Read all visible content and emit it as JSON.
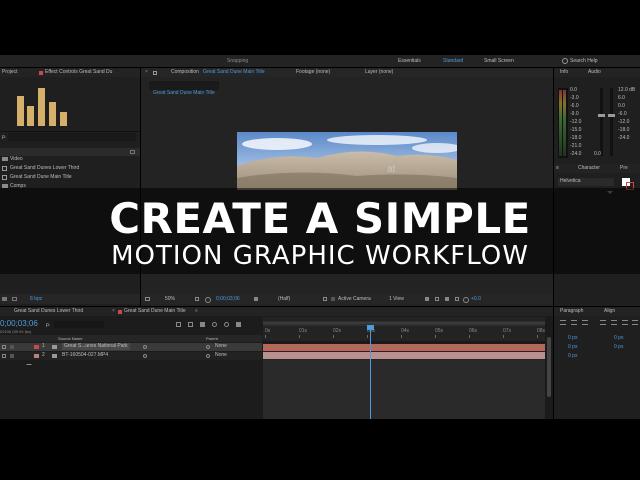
{
  "top_bar": {
    "workspace_label": "Snapping",
    "essentials": "Essentials",
    "standard": "Standard",
    "small_screen": "Small Screen",
    "search": "Search Help"
  },
  "project_panel": {
    "tab_project": "Project",
    "tab_effect_controls": "Effect Controls Great Sand Du",
    "search_icon_glyph": "ρ.",
    "items": [
      {
        "name": "Video",
        "icon": "folder-icon"
      },
      {
        "name": "Great Sand Dunes Lower Third",
        "icon": "composition-icon"
      },
      {
        "name": "Great Sand Dune Main Title",
        "icon": "composition-icon"
      },
      {
        "name": "Comps",
        "icon": "folder-icon"
      }
    ],
    "bpc": "8 bpc"
  },
  "composition_panel": {
    "tab_prefix": "Composition",
    "tab_name": "Great Sand Dune Main Title",
    "footage_tab": "Footage (none)",
    "layer_tab": "Layer (none)",
    "active_chip": "Great Sand Dune Main Title",
    "watermark": "at",
    "zoom": "50%",
    "timecode": "0;00;03;06",
    "resolution": "(Half)",
    "camera": "Active Camera",
    "views": "1 View",
    "exposure": "+0.0"
  },
  "right_panel": {
    "tab_info": "Info",
    "tab_audio": "Audio",
    "meter_left": [
      "0.0",
      "-3.0",
      "-6.0",
      "-9.0",
      "-12.0",
      "-15.0",
      "-18.0",
      "-21.0",
      "-24.0"
    ],
    "meter_right": [
      "12.0 dB",
      "6.0",
      "0.0",
      "-6.0",
      "-12.0",
      "-18.0",
      "-24.0"
    ],
    "meter_right_unit": "dB",
    "meter_mid_zero": "0.0",
    "tab_character": "Character",
    "tab_pre": "Pre",
    "font": "Helvetica",
    "tab_paragraph": "Paragraph",
    "tab_align": "Align",
    "para_values": [
      "0 px",
      "0 px",
      "0 px",
      "0 px",
      "0 px"
    ]
  },
  "title_overlay": {
    "line1": "CREATE A SIMPLE",
    "line2": "MOTION GRAPHIC WORKFLOW"
  },
  "timeline": {
    "tab_lower_third": "Great Sand Dunes Lower Third",
    "tab_main_title": "Great Sand Dune Main Title",
    "timecode": "0;00;03;06",
    "fps": "00106 (59.94 fps)",
    "search_glyph": "ρ.",
    "col_source": "Source Name",
    "col_parent": "Parent",
    "ruler": [
      "0s",
      "01s",
      "02s",
      "03s",
      "04s",
      "05s",
      "06s",
      "07s",
      "08s"
    ],
    "playhead_seconds": 3.1,
    "layers": [
      {
        "num": "1",
        "name": "Great S...unes National Park",
        "parent": "None",
        "selected": true
      },
      {
        "num": "2",
        "name": "BT-160504-027.MP4",
        "parent": "None",
        "selected": false
      }
    ]
  },
  "colors": {
    "accent_blue": "#4e9bdc",
    "label_red": "#c94a4a",
    "label_pink": "#b88080",
    "logo_gold": "#d4b06a",
    "track_green": "#7a8f3a"
  }
}
